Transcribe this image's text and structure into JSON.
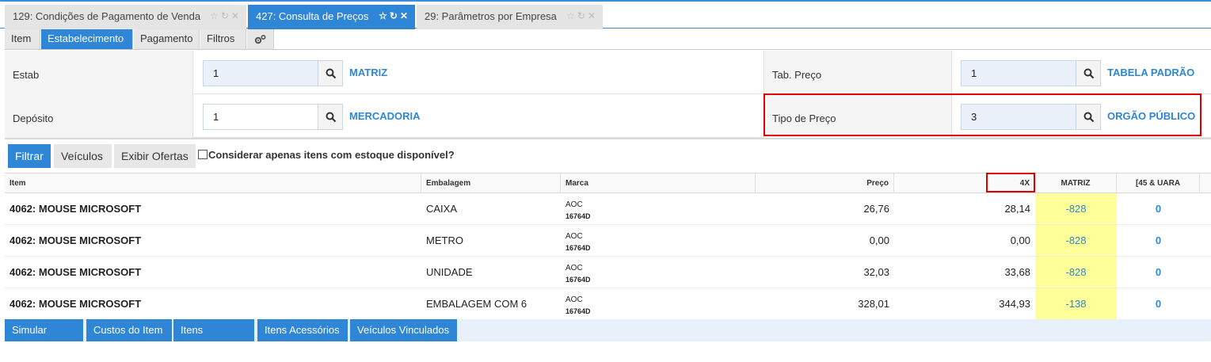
{
  "tabs": [
    {
      "label": "129: Condições de Pagamento de Venda",
      "active": false
    },
    {
      "label": "427: Consulta de Preços",
      "active": true
    },
    {
      "label": "29: Parâmetros por Empresa",
      "active": false
    }
  ],
  "subtabs": [
    "Item",
    "Estabelecimento",
    "Pagamento",
    "Filtros"
  ],
  "form": {
    "estab": {
      "label": "Estab",
      "value": "1",
      "desc": "MATRIZ"
    },
    "deposito": {
      "label": "Depósito",
      "value": "1",
      "desc": "MERCADORIA"
    },
    "tab_preco": {
      "label": "Tab. Preço",
      "value": "1",
      "desc": "TABELA PADRÃO"
    },
    "tipo_preco": {
      "label": "Tipo de Preço",
      "value": "3",
      "desc": "ORGÃO PÚBLICO"
    }
  },
  "toolbar": {
    "filtrar": "Filtrar",
    "veiculos": "Veículos",
    "exibir_ofertas": "Exibir Ofertas",
    "checkbox_label": "Considerar apenas itens com estoque disponível?"
  },
  "grid": {
    "headers": {
      "item": "Item",
      "embalagem": "Embalagem",
      "marca": "Marca",
      "preco": "Preço",
      "x4": "4X",
      "matriz": "MATRIZ",
      "x45": "[45 & UARA"
    },
    "rows": [
      {
        "item": "4062: MOUSE MICROSOFT",
        "embalagem": "CAIXA",
        "marca": "AOC",
        "codigo": "16764D",
        "preco": "26,76",
        "x4": "28,14",
        "matriz": "-828",
        "x45": "0"
      },
      {
        "item": "4062: MOUSE MICROSOFT",
        "embalagem": "METRO",
        "marca": "AOC",
        "codigo": "16764D",
        "preco": "0,00",
        "x4": "0,00",
        "matriz": "-828",
        "x45": "0"
      },
      {
        "item": "4062: MOUSE MICROSOFT",
        "embalagem": "UNIDADE",
        "marca": "AOC",
        "codigo": "16764D",
        "preco": "32,03",
        "x4": "33,68",
        "matriz": "-828",
        "x45": "0"
      },
      {
        "item": "4062: MOUSE MICROSOFT",
        "embalagem": "EMBALAGEM COM 6",
        "marca": "AOC",
        "codigo": "16764D",
        "preco": "328,01",
        "x4": "344,93",
        "matriz": "-138",
        "x45": "0"
      }
    ]
  },
  "bottom_buttons": [
    "Simular Preço",
    "Custos do Item",
    "Itens Similares",
    "Itens Acessórios",
    "Veículos Vinculados"
  ],
  "colors": {
    "accent": "#2f86d6",
    "highlight": "#ffff99",
    "annotation": "#e00000"
  },
  "icons": [
    "star-icon",
    "refresh-icon",
    "close-icon",
    "gears-icon",
    "search-icon"
  ]
}
